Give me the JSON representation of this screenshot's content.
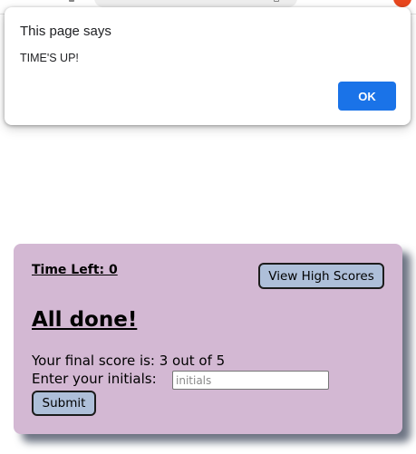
{
  "dialog": {
    "title": "This page says",
    "message": "TIME'S UP!",
    "ok_label": "OK"
  },
  "quiz": {
    "time_left": "Time Left: 0",
    "high_scores_label": "View High Scores",
    "heading": "All done!",
    "score_text": "Your final score is: 3 out of 5",
    "initials_label": "Enter your initials:",
    "initials_placeholder": "initials",
    "initials_value": "",
    "submit_label": "Submit"
  },
  "colors": {
    "card_background": "#d3b8d3",
    "button_background": "#aebfd9",
    "dialog_ok_background": "#1a73e8",
    "browser_badge": "#e8471e"
  }
}
